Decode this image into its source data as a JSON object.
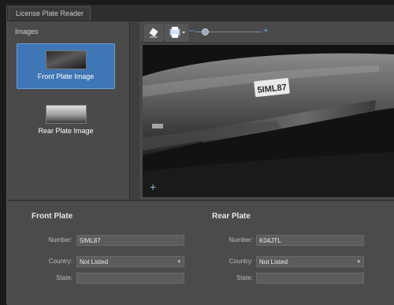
{
  "window": {
    "title": "License Plate Reader"
  },
  "images_panel": {
    "label": "Images",
    "items": [
      {
        "label": "Front Plate Image",
        "selected": true
      },
      {
        "label": "Rear Plate Image",
        "selected": false
      }
    ]
  },
  "viewer": {
    "plate_text": "5IML87",
    "tools": [
      "eraser-icon",
      "printer-icon"
    ],
    "zoom_level": 0.15
  },
  "front_plate": {
    "title": "Front Plate",
    "number_label": "Number:",
    "number_value": "5IML87",
    "country_label": "Country:",
    "country_value": "Not Listed",
    "state_label": "State:",
    "state_value": ""
  },
  "rear_plate": {
    "title": "Rear Plate",
    "number_label": "Number:",
    "number_value": "K04JTL",
    "country_label": "Country:",
    "country_value": "Not Listed",
    "state_label": "State:",
    "state_value": ""
  },
  "colors": {
    "selection": "#3f76b5",
    "accent": "#6aa6e8"
  }
}
